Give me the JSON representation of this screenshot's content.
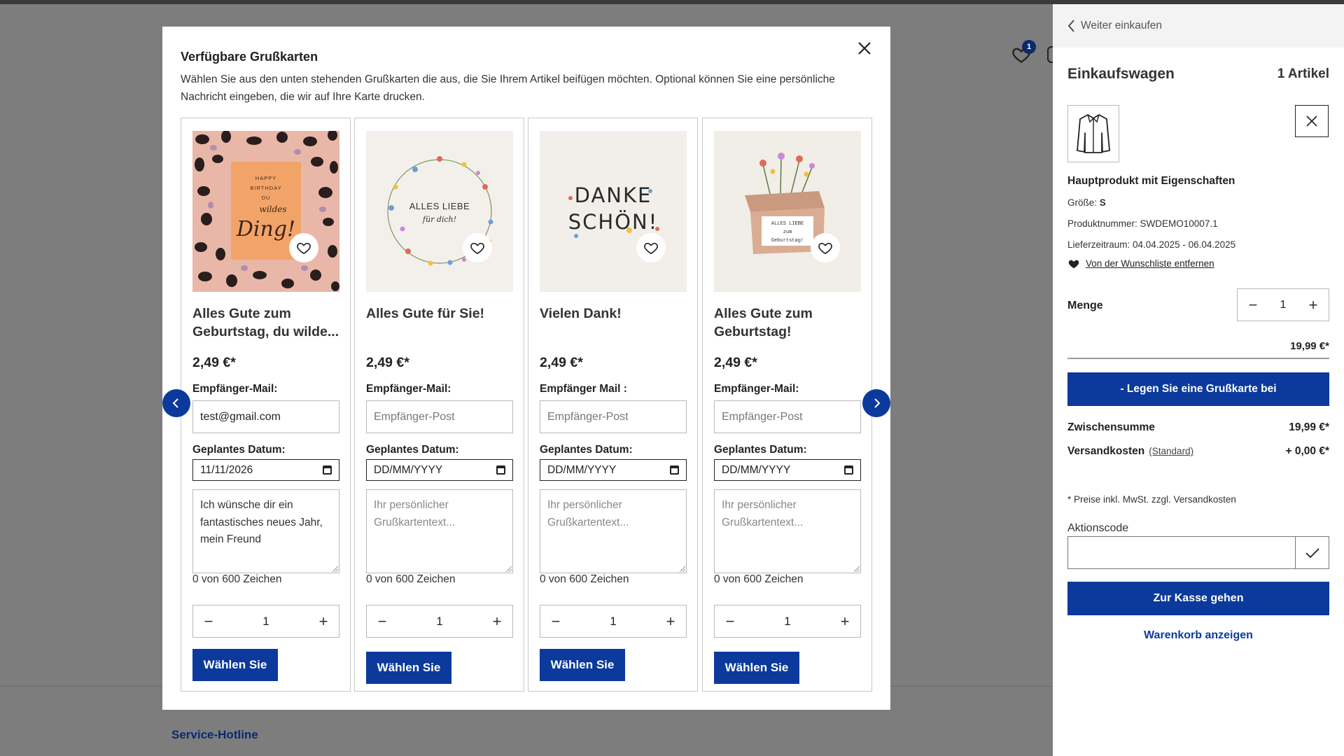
{
  "background": {
    "hotline": "Service-Hotline",
    "wishlist_badge": "1"
  },
  "modal": {
    "title": "Verfügbare Grußkarten",
    "description": "Wählen Sie aus den unten stehenden Grußkarten die aus, die Sie Ihrem Artikel beifügen möchten. Optional können Sie eine persönliche Nachricht eingeben, die wir auf Ihre Karte drucken.",
    "cards": [
      {
        "title": "Alles Gute zum Geburtstag, du wilde...",
        "image_text": [
          "HAPPY",
          "BIRTHDAY",
          "DU",
          "wildes",
          "Ding!"
        ],
        "price": "2,49 €*",
        "mail_label": "Empfänger-Mail:",
        "mail_value": "test@gmail.com",
        "mail_placeholder": "Empfänger-Post",
        "date_label": "Geplantes Datum:",
        "date_value": "11/11/2026",
        "message_value": "Ich wünsche dir ein fantastisches neues Jahr, mein Freund",
        "message_placeholder": "Ihr persönlicher Grußkartentext...",
        "char_count": "0 von 600 Zeichen",
        "qty": "1",
        "choose_label": "Wählen Sie"
      },
      {
        "title": "Alles Gute für Sie!",
        "image_text": [
          "ALLES LIEBE",
          "für dich!"
        ],
        "price": "2,49 €*",
        "mail_label": "Empfänger-Mail:",
        "mail_value": "",
        "mail_placeholder": "Empfänger-Post",
        "date_label": "Geplantes Datum:",
        "date_value": "DD/MM/YYYY",
        "message_value": "",
        "message_placeholder": "Ihr persönlicher Grußkartentext...",
        "char_count": "0 von 600 Zeichen",
        "qty": "1",
        "choose_label": "Wählen Sie"
      },
      {
        "title": "Vielen Dank!",
        "image_text": [
          "DANKE",
          "SCHÖN!"
        ],
        "price": "2,49 €*",
        "mail_label": "Empfänger Mail :",
        "mail_value": "",
        "mail_placeholder": "Empfänger-Post",
        "date_label": "Geplantes Datum:",
        "date_value": "DD/MM/YYYY",
        "message_value": "",
        "message_placeholder": "Ihr persönlicher Grußkartentext...",
        "char_count": "0 von 600 Zeichen",
        "qty": "1",
        "choose_label": "Wählen Sie"
      },
      {
        "title": "Alles Gute zum Geburtstag!",
        "image_text": [
          "ALLES LIEBE",
          "zum",
          "Geburtstag!"
        ],
        "price": "2,49 €*",
        "mail_label": "Empfänger-Mail:",
        "mail_value": "",
        "mail_placeholder": "Empfänger-Post",
        "date_label": "Geplantes Datum:",
        "date_value": "DD/MM/YYYY",
        "message_value": "",
        "message_placeholder": "Ihr persönlicher Grußkartentext...",
        "char_count": "0 von 600 Zeichen",
        "qty": "1",
        "choose_label": "Wählen Sie"
      }
    ]
  },
  "cart": {
    "back_label": "Weiter einkaufen",
    "title": "Einkaufswagen",
    "count": "1 Artikel",
    "product": {
      "name": "Hauptprodukt mit Eigenschaften",
      "size_label": "Größe:",
      "size_value": "S",
      "number": "Produktnummer: SWDEMO10007.1",
      "delivery": "Lieferzeitraum: 04.04.2025 - 06.04.2025",
      "wishlist_remove": "Von der Wunschliste entfernen"
    },
    "qty_label": "Menge",
    "qty": "1",
    "line_price": "19,99 €*",
    "gift_button": "- Legen Sie eine Grußkarte bei",
    "subtotal_label": "Zwischensumme",
    "subtotal_value": "19,99 €*",
    "shipping_label": "Versandkosten",
    "shipping_method": "(Standard)",
    "shipping_value": "+ 0,00 €*",
    "vat_note": "* Preise inkl. MwSt. zzgl. Versandkosten",
    "promo_label": "Aktionscode",
    "promo_value": "",
    "checkout_label": "Zur Kasse gehen",
    "view_cart_label": "Warenkorb anzeigen"
  },
  "colors": {
    "primary": "#0b3a9c",
    "overlay": "#7d7d7d"
  }
}
